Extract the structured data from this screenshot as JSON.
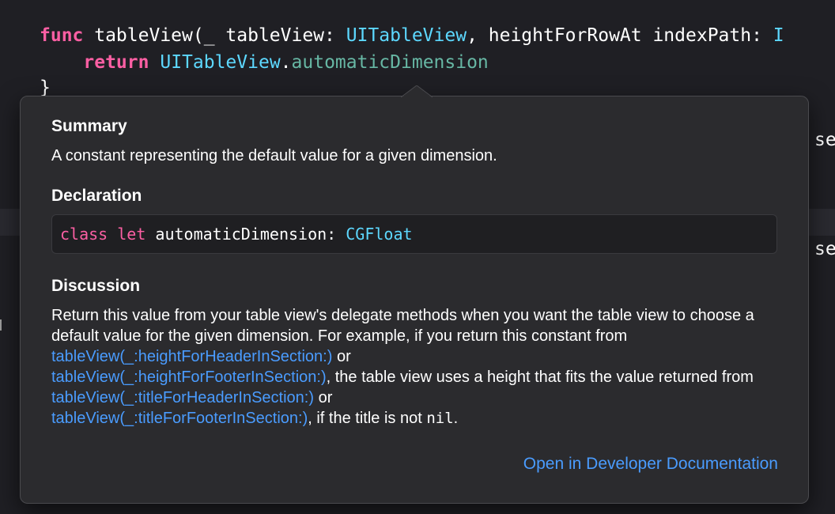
{
  "code": {
    "line1": {
      "kw": "func",
      "name": " tableView(_ tableView: ",
      "param_type": "UITableView",
      "rest": ", heightForRowAt indexPath: ",
      "trailing": "I"
    },
    "line2": {
      "indent": "    ",
      "kw": "return",
      "space": " ",
      "type": "UITableView",
      "dot": ".",
      "member": "automaticDimension"
    },
    "line3": "}",
    "right_fragments": [
      "se",
      "se"
    ]
  },
  "popover": {
    "summary_title": "Summary",
    "summary_text": "A constant representing the default value for a given dimension.",
    "declaration_title": "Declaration",
    "declaration": {
      "kw": "class let",
      "name": " automaticDimension: ",
      "type": "CGFloat"
    },
    "discussion_title": "Discussion",
    "discussion": {
      "t1": "Return this value from your table view's delegate methods when you want the table view to choose a default value for the given dimension. For example, if you return this constant from ",
      "link1": "tableView(_:heightForHeaderInSection:)",
      "t2": " or ",
      "link2": "tableView(_:heightForFooterInSection:)",
      "t3": ", the table view uses a height that fits the value returned from ",
      "link3": "tableView(_:titleForHeaderInSection:)",
      "t4": " or ",
      "link4": "tableView(_:titleForFooterInSection:)",
      "t5": ", if the title is not ",
      "nil": "nil",
      "t6": "."
    },
    "open_docs_link": "Open in Developer Documentation"
  },
  "colors": {
    "background": "#1f1f24",
    "keyword": "#fc5fa3",
    "type": "#5dd8ff",
    "member": "#67b7a4",
    "link": "#4a9cff",
    "popover_bg": "#2b2b2e"
  }
}
